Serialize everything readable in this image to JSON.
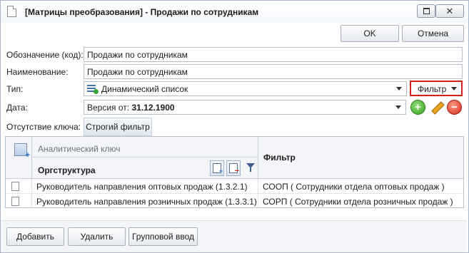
{
  "window": {
    "title": "[Матрицы преобразования] - Продажи по сотрудникам"
  },
  "actions": {
    "ok": "OK",
    "cancel": "Отмена"
  },
  "form": {
    "code_label": "Обозначение (код):",
    "code_value": "Продажи по сотрудникам",
    "name_label": "Наименование:",
    "name_value": "Продажи по сотрудникам",
    "type_label": "Тип:",
    "type_value": "Динамический список",
    "filter_button": "Фильтр",
    "date_label": "Дата:",
    "date_prefix": "Версия от:",
    "date_value": "31.12.1900",
    "missing_key_label": "Отсутствие ключа:",
    "missing_key_value": "Строгий фильтр"
  },
  "grid": {
    "group_header": "Аналитический ключ",
    "col_org": "Оргструктура",
    "col_filter": "Фильтр",
    "rows": [
      {
        "org": "Руководитель направления оптовых продаж (1.3.2.1)",
        "filter": "СООП  ( Сотрудники отдела оптовых продаж )"
      },
      {
        "org": "Руководитель направления розничных продаж (1.3.3.1)",
        "filter": "СОРП  ( Сотрудники отдела розничных продаж )"
      }
    ]
  },
  "bottom": {
    "add": "Добавить",
    "delete": "Удалить",
    "group_input": "Групповой ввод"
  },
  "colors": {
    "highlight_border": "#d62020",
    "add_icon": "#3aa01f",
    "delete_icon": "#d42a1b"
  }
}
